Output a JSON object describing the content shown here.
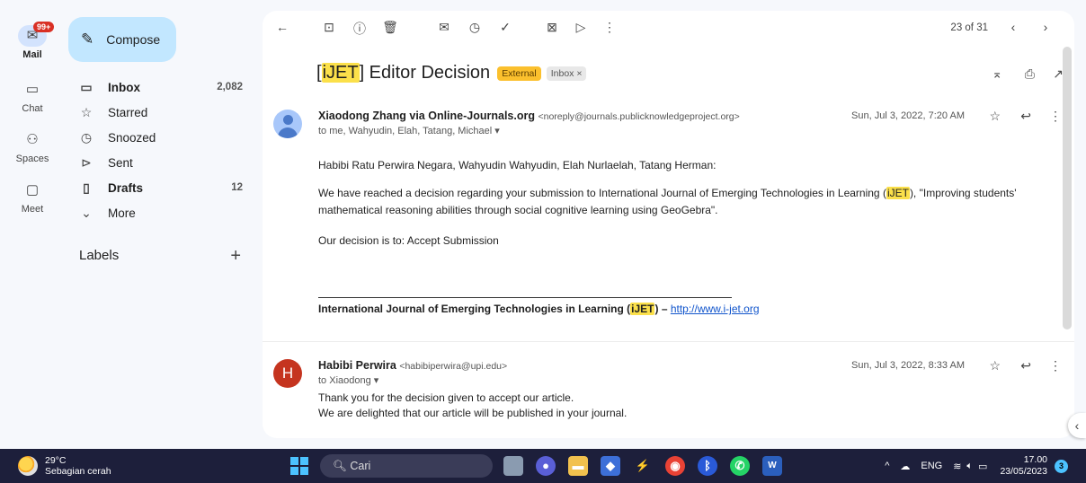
{
  "rail": {
    "mail_badge": "99+",
    "items": [
      {
        "label": "Mail",
        "icon": "mail-icon"
      },
      {
        "label": "Chat",
        "icon": "chat-icon"
      },
      {
        "label": "Spaces",
        "icon": "spaces-icon"
      },
      {
        "label": "Meet",
        "icon": "meet-icon"
      }
    ]
  },
  "nav": {
    "compose_label": "Compose",
    "items": [
      {
        "label": "Inbox",
        "count": "2,082",
        "icon": "inbox-icon"
      },
      {
        "label": "Starred",
        "count": "",
        "icon": "star-icon"
      },
      {
        "label": "Snoozed",
        "count": "",
        "icon": "clock-icon"
      },
      {
        "label": "Sent",
        "count": "",
        "icon": "send-icon"
      },
      {
        "label": "Drafts",
        "count": "12",
        "icon": "draft-icon"
      },
      {
        "label": "More",
        "count": "",
        "icon": "chevron-down-icon"
      }
    ],
    "labels_heading": "Labels"
  },
  "toolbar": {
    "page_info": "23 of 31"
  },
  "thread": {
    "subject_prefix": "[",
    "subject_highlight": "iJET",
    "subject_rest": "] Editor Decision",
    "tag_external": "External",
    "tag_inbox": "Inbox ×"
  },
  "messages": [
    {
      "sender_name": "Xiaodong Zhang via Online-Journals.org",
      "sender_email": "<noreply@journals.publicknowledgeproject.org>",
      "to": "to me, Wahyudin, Elah, Tatang, Michael ▾",
      "date": "Sun, Jul 3, 2022, 7:20 AM",
      "salutation": "Habibi Ratu Perwira Negara, Wahyudin Wahyudin, Elah Nurlaelah, Tatang Herman:",
      "p1_before": "We have reached a decision regarding your submission to International Journal of Emerging Technologies in Learning (",
      "p1_highlight": "iJET",
      "p1_after": "), \"Improving students' mathematical reasoning abilities through social cognitive learning using GeoGebra\".",
      "decision": "Our decision is to: Accept Submission",
      "sig_before": "International Journal of Emerging Technologies in Learning (",
      "sig_highlight": "iJET",
      "sig_after": ") – ",
      "sig_link": "http://www.i-jet.org"
    },
    {
      "avatar_letter": "H",
      "sender_name": "Habibi Perwira",
      "sender_email": "<habibiperwira@upi.edu>",
      "to": "to Xiaodong ▾",
      "date": "Sun, Jul 3, 2022, 8:33 AM",
      "line1": "Thank you for the decision given to accept our article.",
      "line2": "We are delighted that our article will be published in your journal."
    }
  ],
  "taskbar": {
    "temperature": "29°C",
    "weather_desc": "Sebagian cerah",
    "search_placeholder": "Cari",
    "lang": "ENG",
    "time": "17.00",
    "date": "23/05/2023",
    "notification_count": "3"
  }
}
